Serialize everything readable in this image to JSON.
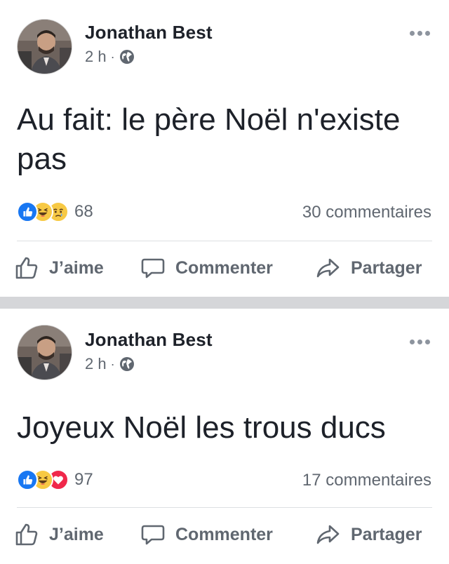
{
  "posts": [
    {
      "author": "Jonathan Best",
      "time": "2 h",
      "separator": "·",
      "privacy_icon": "globe-icon",
      "text": "Au fait: le père Noël n'existe pas",
      "reaction_icons": [
        "like-icon",
        "haha-icon",
        "sad-icon"
      ],
      "reaction_count": "68",
      "comments": "30 commentaires"
    },
    {
      "author": "Jonathan Best",
      "time": "2 h",
      "separator": "·",
      "privacy_icon": "globe-icon",
      "text": "Joyeux Noël les trous ducs",
      "reaction_icons": [
        "like-icon",
        "haha-icon",
        "love-icon"
      ],
      "reaction_count": "97",
      "comments": "17 commentaires"
    }
  ],
  "actions": {
    "like": "J’aime",
    "comment": "Commenter",
    "share": "Partager"
  },
  "colors": {
    "like_blue": "#1877f2",
    "haha_yellow": "#f7c944",
    "love_red": "#f0284a",
    "text_gray": "#606770",
    "separator_gray": "#d5d6d9"
  }
}
